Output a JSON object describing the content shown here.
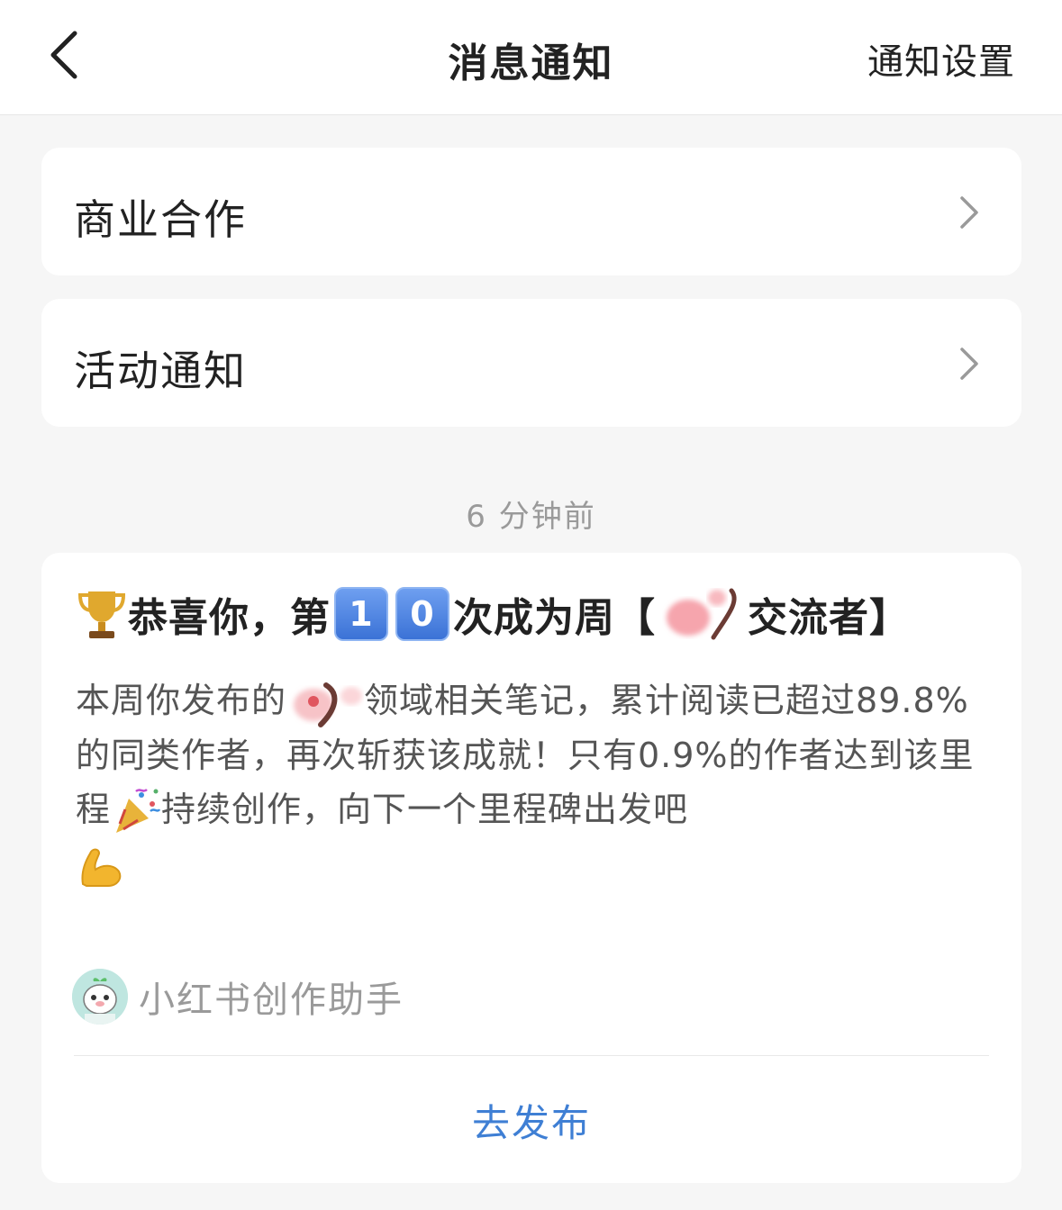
{
  "header": {
    "title": "消息通知",
    "settings_label": "通知设置"
  },
  "rows": [
    {
      "label": "商业合作"
    },
    {
      "label": "活动通知"
    }
  ],
  "timestamp": "6 分钟前",
  "message": {
    "title_prefix": "恭喜你，第",
    "digit_1": "1",
    "digit_2": "0",
    "title_mid": "次成为周【",
    "title_suffix": "交流者】",
    "body_part1": "本周你发布的",
    "body_part2": "领域相关笔记，累计阅读已超过89.8%的同类作者，再次斩获该成就！只有0.9%的作者达到该里程",
    "body_part3": "持续创作，向下一个里程碑出发吧",
    "sender_name": "小红书创作助手",
    "action_label": "去发布"
  },
  "colors": {
    "background": "#f6f6f6",
    "card": "#ffffff",
    "accent_link": "#3f7fd4",
    "muted_text": "#9a9a9a"
  }
}
